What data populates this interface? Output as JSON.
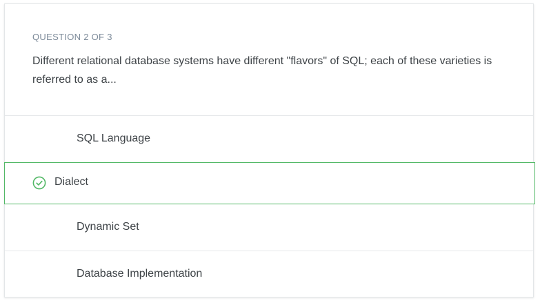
{
  "question": {
    "counter": "QUESTION 2 OF 3",
    "text": "Different relational database systems have different \"flavors\" of SQL; each of these varieties is referred to as a..."
  },
  "options": [
    {
      "label": "SQL Language",
      "selected": false
    },
    {
      "label": "Dialect",
      "selected": true
    },
    {
      "label": "Dynamic Set",
      "selected": false
    },
    {
      "label": "Database Implementation",
      "selected": false
    }
  ],
  "colors": {
    "accent_green": "#52b866",
    "text": "#3d4246",
    "muted": "#7c8a99",
    "divider": "#e6e8ea"
  },
  "icons": {
    "selected_option": "check-circle-icon"
  }
}
